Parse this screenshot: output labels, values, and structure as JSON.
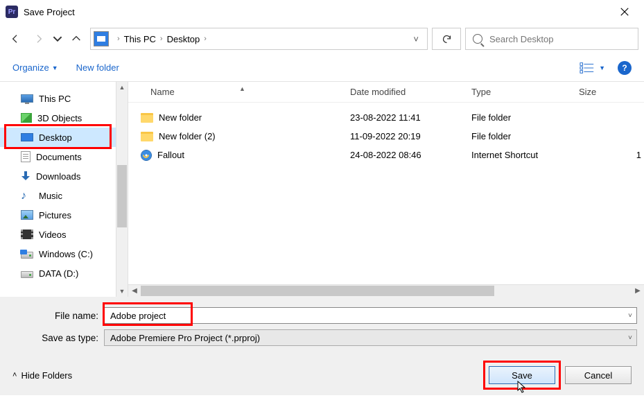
{
  "title": "Save Project",
  "breadcrumb": {
    "items": [
      "This PC",
      "Desktop"
    ]
  },
  "search": {
    "placeholder": "Search Desktop"
  },
  "toolbar": {
    "organize": "Organize",
    "newfolder": "New folder"
  },
  "columns": {
    "name": "Name",
    "date": "Date modified",
    "type": "Type",
    "size": "Size"
  },
  "tree": [
    {
      "label": "This PC",
      "icon": "pc"
    },
    {
      "label": "3D Objects",
      "icon": "cube"
    },
    {
      "label": "Desktop",
      "icon": "desk",
      "selected": true
    },
    {
      "label": "Documents",
      "icon": "doc"
    },
    {
      "label": "Downloads",
      "icon": "dl"
    },
    {
      "label": "Music",
      "icon": "mus"
    },
    {
      "label": "Pictures",
      "icon": "pic"
    },
    {
      "label": "Videos",
      "icon": "vid"
    },
    {
      "label": "Windows (C:)",
      "icon": "drvc"
    },
    {
      "label": "DATA (D:)",
      "icon": "drv"
    }
  ],
  "files": [
    {
      "name": "New folder",
      "date": "23-08-2022 11:41",
      "type": "File folder",
      "icon": "folder"
    },
    {
      "name": "New folder (2)",
      "date": "11-09-2022 20:19",
      "type": "File folder",
      "icon": "folder"
    },
    {
      "name": "Fallout",
      "date": "24-08-2022 08:46",
      "type": "Internet Shortcut",
      "icon": "ie",
      "size": "1"
    }
  ],
  "fields": {
    "filename_label": "File name:",
    "filename_value": "Adobe project",
    "savetype_label": "Save as type:",
    "savetype_value": "Adobe Premiere Pro Project (*.prproj)"
  },
  "footer": {
    "hide": "Hide Folders",
    "save": "Save",
    "cancel": "Cancel"
  }
}
